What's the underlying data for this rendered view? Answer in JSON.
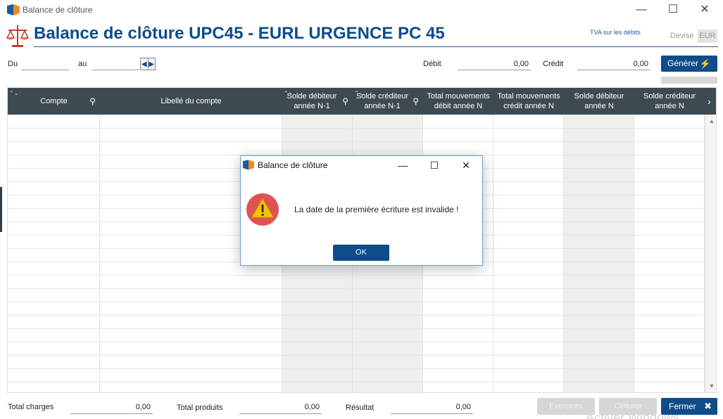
{
  "window": {
    "title": "Balance de clôture",
    "minimize_glyph": "—",
    "maximize_glyph": "☐",
    "close_glyph": "✕"
  },
  "header": {
    "title": "Balance de clôture UPC45 - EURL URGENCE PC 45",
    "tva_link": "TVA sur les débits",
    "devise_label": "Devise",
    "devise_value": "EUR",
    "icon": "scales-icon"
  },
  "filters": {
    "du_label": "Du",
    "du_value": "",
    "au_label": "au",
    "au_value": "",
    "debit_label": "Débit",
    "debit_value": "0,00",
    "credit_label": "Crédit",
    "credit_value": "0,00",
    "generer_label": "Générer",
    "prev_glyph": "◀",
    "next_glyph": "▶",
    "bolt_glyph": "⚡"
  },
  "grid": {
    "columns": [
      {
        "label": "Compte",
        "sortable": true,
        "searchable": true
      },
      {
        "label": "Libellé du compte",
        "sortable": false,
        "searchable": false
      },
      {
        "label": "Solde débiteur année N-1",
        "sortable": true,
        "searchable": true
      },
      {
        "label": "Solde créditeur année N-1",
        "sortable": true,
        "searchable": true
      },
      {
        "label": "Total mouvements débit année N",
        "sortable": false,
        "searchable": false
      },
      {
        "label": "Total mouvements crédit année N",
        "sortable": false,
        "searchable": false
      },
      {
        "label": "Solde débiteur année N",
        "sortable": false,
        "searchable": false
      },
      {
        "label": "Solde créditeur année N",
        "sortable": false,
        "searchable": false
      }
    ],
    "sort_glyph": "⌃⌄",
    "search_glyph": "⚲",
    "scroll_right_glyph": "›",
    "scroll_up_glyph": "▲",
    "scroll_down_glyph": "▼"
  },
  "footer": {
    "total_charges_label": "Total charges",
    "total_charges_value": "0,00",
    "total_produits_label": "Total produits",
    "total_produits_value": "0,00",
    "resultat_label": "Résultat",
    "resultat_value": "0,00",
    "exercices_label": "Exercices",
    "cloturer_label": "Clôturer",
    "fermer_label": "Fermer",
    "fermer_icon_glyph": "✖",
    "watermark": "Activer Windows"
  },
  "dialog": {
    "title": "Balance de clôture",
    "message": "La date de la première écriture est invalide !",
    "ok_label": "OK",
    "icon": "warning-icon"
  },
  "colors": {
    "accent": "#0e4c8a",
    "grid_header": "#3e4a52",
    "warning_red": "#e05252",
    "warning_yellow": "#f5c400"
  }
}
